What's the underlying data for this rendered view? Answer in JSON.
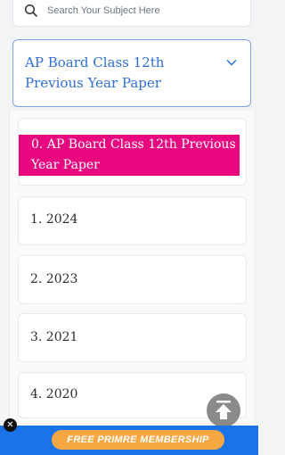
{
  "search": {
    "placeholder": "Search Your Subject Here",
    "icon": "search-icon"
  },
  "dropdown": {
    "selected": "AP Board Class 12th Previous Year Paper",
    "icon": "chevron-down-icon"
  },
  "list": {
    "items": [
      {
        "label": "0. AP Board Class 12th Previous Year Paper",
        "highlight_color": "#e8077f"
      },
      {
        "label": "1. 2024"
      },
      {
        "label": "2. 2023"
      },
      {
        "label": "3. 2021"
      },
      {
        "label": "4. 2020"
      }
    ]
  },
  "scroll_top": {
    "icon": "arrow-up-to-top-icon"
  },
  "banner": {
    "button_label": "FREE PRIMRE MEMBERSHIP",
    "background": "#1a73e8",
    "button_color": "#f6a742"
  },
  "close": {
    "icon": "close-icon",
    "glyph": "✕"
  }
}
